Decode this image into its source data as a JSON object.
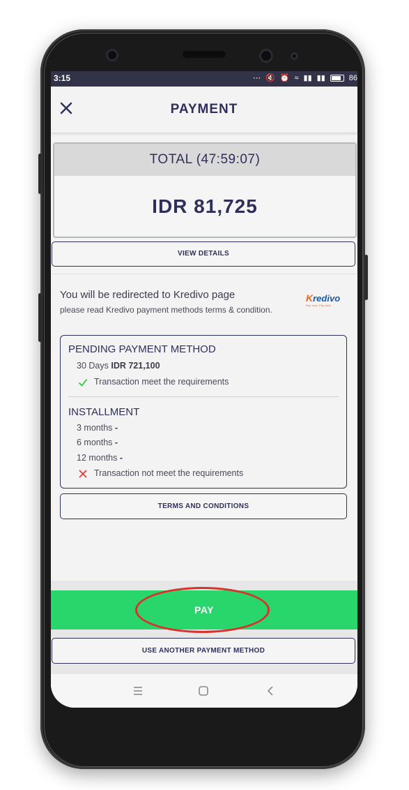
{
  "statusbar": {
    "time": "3:15",
    "battery": "86"
  },
  "header": {
    "title": "PAYMENT"
  },
  "total": {
    "label": "TOTAL (47:59:07)",
    "amount": "IDR 81,725"
  },
  "view_details_label": "VIEW DETAILS",
  "redirect": {
    "title": "You will be redirected to Kredivo page",
    "note": "please read Kredivo payment methods terms & condition."
  },
  "kredivo_logo": {
    "k": "K",
    "rest": "redivo",
    "tagline": "Buy now, Pay later"
  },
  "pending": {
    "heading": "PENDING PAYMENT METHOD",
    "term": "30 Days",
    "amount": "IDR 721,100",
    "status": "Transaction meet the requirements",
    "status_color": "#2ecc40"
  },
  "installment": {
    "heading": "INSTALLMENT",
    "options": [
      {
        "term": "3 months",
        "value": "-"
      },
      {
        "term": "6 months",
        "value": "-"
      },
      {
        "term": "12 months",
        "value": "-"
      }
    ],
    "status": "Transaction not meet the requirements",
    "status_color": "#e53935"
  },
  "terms_label": "TERMS AND CONDITIONS",
  "pay_label": "PAY",
  "another_label": "USE ANOTHER PAYMENT METHOD",
  "colors": {
    "accent": "#2f2f5c",
    "pay": "#28d66b",
    "highlight": "#d9322d"
  }
}
